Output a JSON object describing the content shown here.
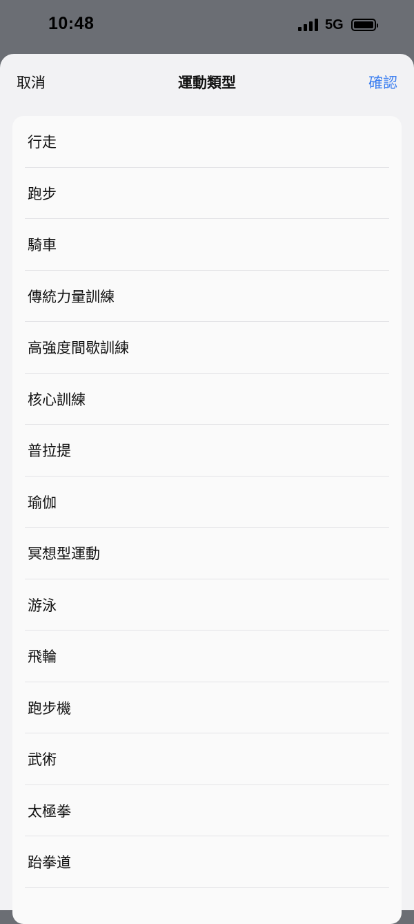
{
  "status_bar": {
    "time": "10:48",
    "network": "5G",
    "icons": [
      "signal-icon",
      "battery-icon"
    ]
  },
  "nav": {
    "cancel_label": "取消",
    "title": "運動類型",
    "confirm_label": "確認"
  },
  "colors": {
    "accent": "#3b7ef0",
    "backdrop": "#6b6e74",
    "sheet": "#f2f2f4",
    "card": "#fafafa",
    "separator": "#e3e3e6"
  },
  "exercise_types": [
    "行走",
    "跑步",
    "騎車",
    "傳統力量訓練",
    "高強度間歇訓練",
    "核心訓練",
    "普拉提",
    "瑜伽",
    "冥想型運動",
    "游泳",
    "飛輪",
    "跑步機",
    "武術",
    "太極拳",
    "跆拳道"
  ]
}
